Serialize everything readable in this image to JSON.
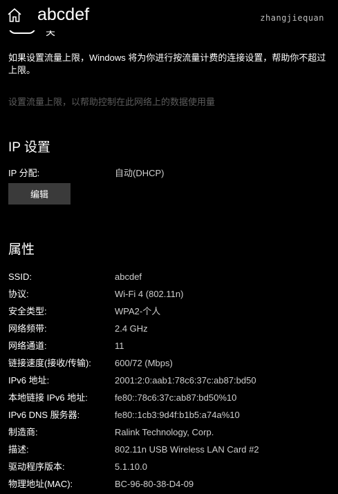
{
  "header": {
    "title": "abcdef",
    "watermark": "zhangjiequan",
    "home_icon": "home-icon"
  },
  "metered": {
    "toggle_state": "关",
    "description": "如果设置流量上限，Windows 将为你进行按流量计费的连接设置，帮助你不超过上限。",
    "set_limit_link": "设置流量上限，以帮助控制在此网络上的数据使用量"
  },
  "ip_settings": {
    "heading": "IP 设置",
    "assignment_label": "IP 分配:",
    "assignment_value": "自动(DHCP)",
    "edit_button": "编辑"
  },
  "properties": {
    "heading": "属性",
    "rows": [
      {
        "label": "SSID:",
        "value": "abcdef"
      },
      {
        "label": "协议:",
        "value": "Wi-Fi 4 (802.11n)"
      },
      {
        "label": "安全类型:",
        "value": "WPA2-个人"
      },
      {
        "label": "网络频带:",
        "value": "2.4 GHz"
      },
      {
        "label": "网络通道:",
        "value": "11"
      },
      {
        "label": "链接速度(接收/传输):",
        "value": "600/72 (Mbps)"
      },
      {
        "label": "IPv6 地址:",
        "value": "2001:2:0:aab1:78c6:37c:ab87:bd50"
      },
      {
        "label": "本地链接 IPv6 地址:",
        "value": "fe80::78c6:37c:ab87:bd50%10"
      },
      {
        "label": "IPv6 DNS 服务器:",
        "value": "fe80::1cb3:9d4f:b1b5:a74a%10"
      },
      {
        "label": "制造商:",
        "value": "Ralink Technology, Corp."
      },
      {
        "label": "描述:",
        "value": "802.11n USB Wireless LAN Card #2"
      },
      {
        "label": "驱动程序版本:",
        "value": "5.1.10.0"
      },
      {
        "label": "物理地址(MAC):",
        "value": "BC-96-80-38-D4-09"
      }
    ]
  },
  "colors": {
    "background": "#000000",
    "text": "#ffffff",
    "value_text": "#cfcfcf",
    "disabled_text": "#5c5c5c",
    "button_bg": "#3a3a3a"
  }
}
